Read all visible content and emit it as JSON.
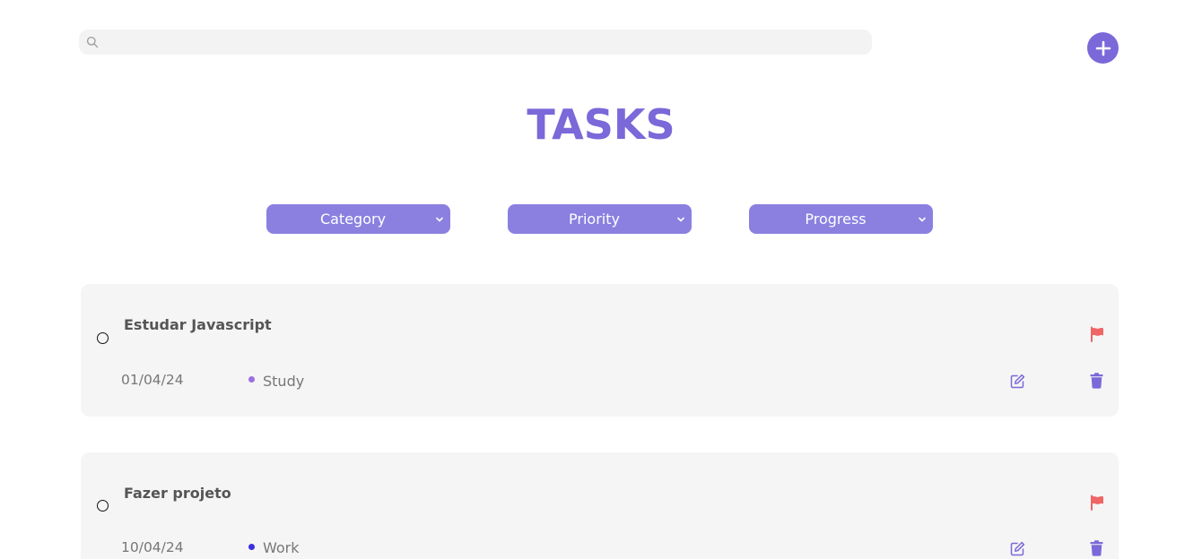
{
  "search": {
    "placeholder": "",
    "value": ""
  },
  "header": {
    "title": "TASKS",
    "add_icon": "plus-icon"
  },
  "filters": [
    {
      "label": "Category"
    },
    {
      "label": "Priority"
    },
    {
      "label": "Progress"
    }
  ],
  "tasks": [
    {
      "title": "Estudar Javascript",
      "date": "01/04/24",
      "category": "Study",
      "category_color": "#9b6fe0",
      "priority_color": "#f06565"
    },
    {
      "title": "Fazer projeto",
      "date": "10/04/24",
      "category": "Work",
      "category_color": "#3b2fe0",
      "priority_color": "#f06565"
    }
  ],
  "colors": {
    "accent": "#7b68d9",
    "filter_bg": "#8b80e0",
    "card_bg": "#f5f5f5",
    "flag": "#f06565",
    "action_icon": "#7b68d9"
  }
}
